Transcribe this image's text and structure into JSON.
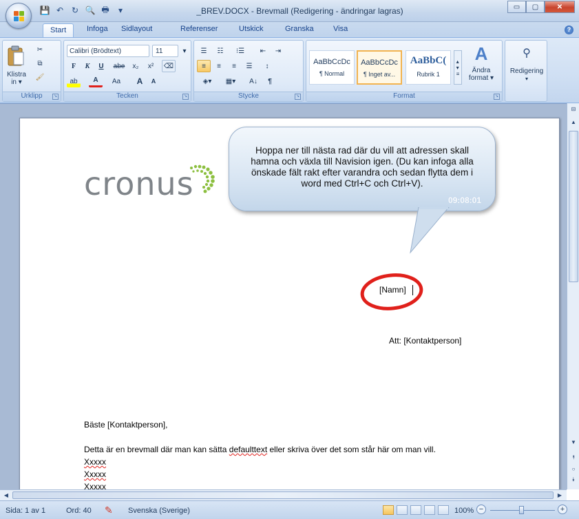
{
  "window": {
    "title": "_BREV.DOCX - Brevmall (Redigering - ändringar lagras)",
    "minimize_symbol": "▭",
    "maximize_symbol": "▢",
    "close_symbol": "✕"
  },
  "quick_access": {
    "save_icon": "💾",
    "undo_icon": "↶",
    "redo_icon": "↻",
    "preview_icon": "🔍",
    "print_icon": "🖶",
    "more_icon": "▾"
  },
  "tabs": [
    "Start",
    "Infoga",
    "Sidlayout",
    "Referenser",
    "Utskick",
    "Granska",
    "Visa"
  ],
  "ribbon": {
    "clipboard": {
      "paste_label": "Klistra",
      "paste_label2": "in ▾",
      "group": "Urklipp"
    },
    "font": {
      "font_name": "Calibri (Brödtext)",
      "font_size": "11",
      "bold": "F",
      "italic": "K",
      "underline": "U",
      "strike": "abe",
      "subscript": "x₂",
      "superscript": "x²",
      "grow": "A",
      "shrink": "A",
      "change_case": "Aa",
      "highlight": "ab",
      "color": "A",
      "group": "Tecken"
    },
    "paragraph": {
      "group": "Stycke",
      "show_marks": "¶",
      "sort": "A↓"
    },
    "styles": {
      "items": [
        {
          "sample": "AaBbCcDc",
          "name": "¶ Normal"
        },
        {
          "sample": "AaBbCcDc",
          "name": "¶ Inget av..."
        },
        {
          "sample": "AaBbC(",
          "name": "Rubrik 1"
        }
      ],
      "change_label": "Ändra",
      "change_label2": "format ▾",
      "group": "Format"
    },
    "editing": {
      "label": "Redigering",
      "arrow": "▾"
    }
  },
  "document": {
    "logo_text": "cronus",
    "callout": {
      "text": "Hoppa ner till nästa rad där du vill att adressen skall hamna och växla till Navision igen. (Du kan infoga alla önskade fält rakt efter varandra och sedan flytta dem i word med Ctrl+C och Ctrl+V).",
      "timestamp": "09:08:01"
    },
    "field_name": "[Namn]",
    "attention_line": "Att: [Kontaktperson]",
    "greeting": "Bäste [Kontaktperson],",
    "body_before": "Detta är en brevmall där man kan sätta ",
    "body_misspelled": "defaulttext",
    "body_after": " eller skriva över det som står här om man vill.",
    "placeholder_lines": [
      "Xxxxx",
      "Xxxxx",
      "Xxxxx"
    ]
  },
  "status": {
    "page": "Sida: 1 av 1",
    "words": "Ord: 40",
    "language": "Svenska (Sverige)",
    "zoom": "100%",
    "zoom_minus": "−",
    "zoom_plus": "+"
  },
  "colors": {
    "highlight_circle": "#e0201b",
    "ribbon_bg": "#cfdff3",
    "doc_bg": "#a8bad4"
  }
}
